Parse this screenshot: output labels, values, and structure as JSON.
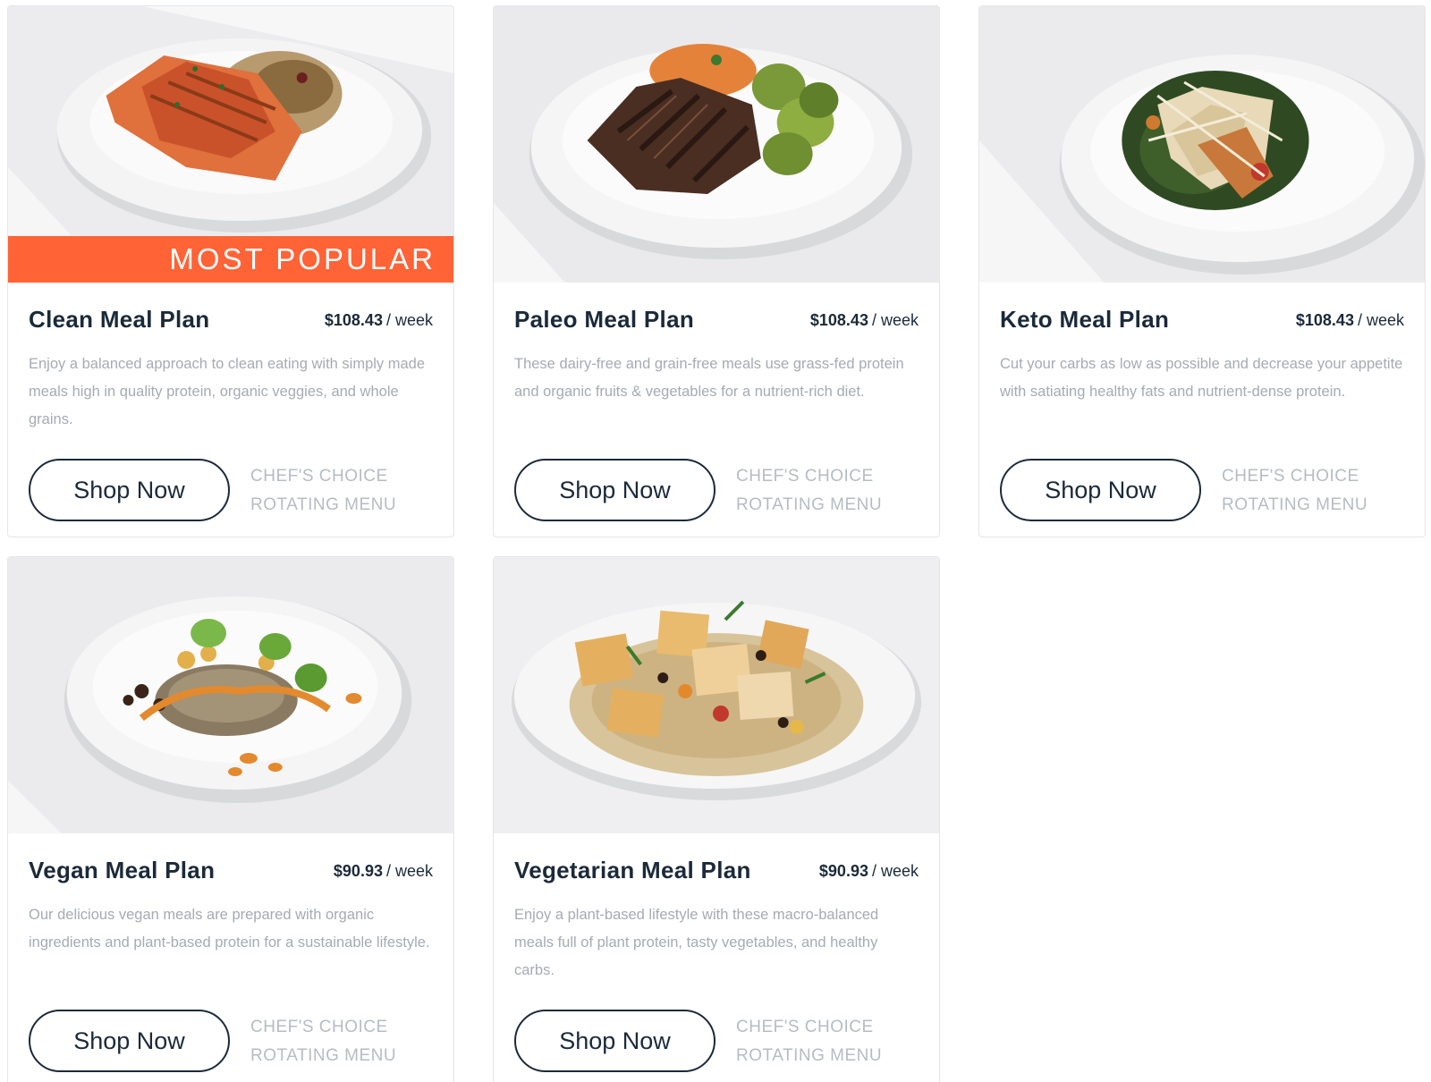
{
  "badge_label": "MOST POPULAR",
  "accent_color": "#ff6336",
  "plans": [
    {
      "title": "Clean Meal Plan",
      "price": "$108.43",
      "per": "/ week",
      "description": "Enjoy a balanced approach to clean eating with simply made meals high in quality protein, organic veggies, and whole grains.",
      "button": "Shop Now",
      "tag_line1": "CHEF'S CHOICE",
      "tag_line2": "ROTATING MENU",
      "image": "salmon-with-grains-plate"
    },
    {
      "title": "Paleo Meal Plan",
      "price": "$108.43",
      "per": "/ week",
      "description": "These dairy-free and grain-free meals use grass-fed protein and organic fruits & vegetables for a nutrient-rich diet.",
      "button": "Shop Now",
      "tag_line1": "CHEF'S CHOICE",
      "tag_line2": "ROTATING MENU",
      "image": "steak-with-brussels-sprouts-plate"
    },
    {
      "title": "Keto Meal Plan",
      "price": "$108.43",
      "per": "/ week",
      "description": "Cut your carbs as low as possible and decrease your appetite with satiating healthy fats and nutrient-dense protein.",
      "button": "Shop Now",
      "tag_line1": "CHEF'S CHOICE",
      "tag_line2": "ROTATING MENU",
      "image": "chicken-with-greens-plate"
    },
    {
      "title": "Vegan Meal Plan",
      "price": "$90.93",
      "per": "/ week",
      "description": "Our delicious vegan meals are prepared with organic ingredients and plant-based protein for a sustainable lifestyle.",
      "button": "Shop Now",
      "tag_line1": "CHEF'S CHOICE",
      "tag_line2": "ROTATING MENU",
      "image": "quinoa-chickpea-bowl-plate"
    },
    {
      "title": "Vegetarian Meal Plan",
      "price": "$90.93",
      "per": "/ week",
      "description": "Enjoy a plant-based lifestyle with these macro-balanced meals full of plant protein, tasty vegetables, and healthy carbs.",
      "button": "Shop Now",
      "tag_line1": "CHEF'S CHOICE",
      "tag_line2": "ROTATING MENU",
      "image": "tofu-quinoa-plate"
    }
  ]
}
